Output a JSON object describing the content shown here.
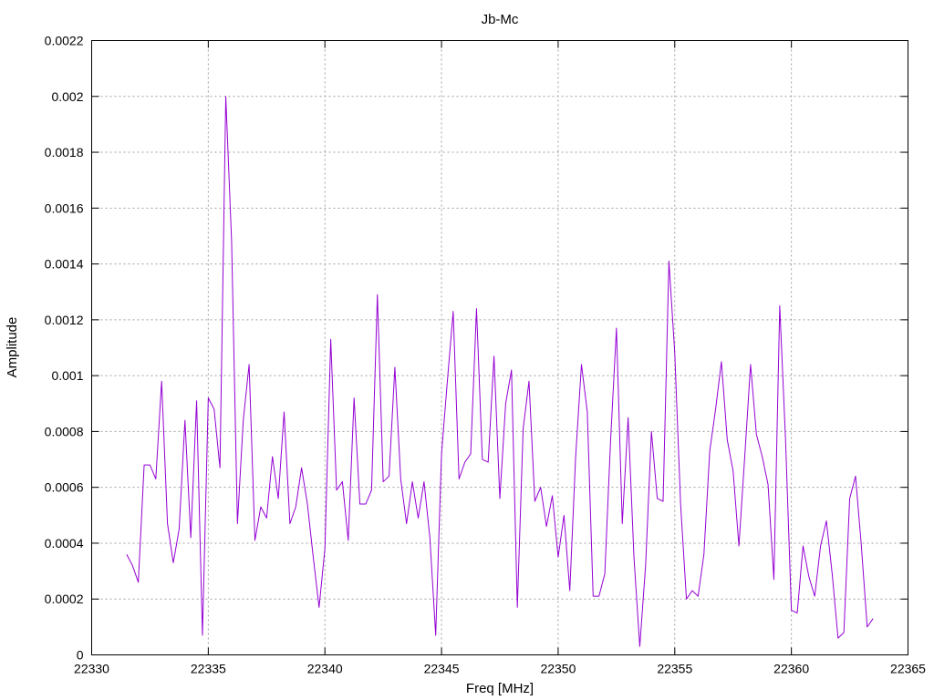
{
  "chart_data": {
    "type": "line",
    "title": "Jb-Mc",
    "xlabel": "Freq [MHz]",
    "ylabel": "Amplitude",
    "xlim": [
      22330,
      22365
    ],
    "ylim": [
      0,
      0.0022
    ],
    "xticks": [
      22330,
      22335,
      22340,
      22345,
      22350,
      22355,
      22360,
      22365
    ],
    "xtick_labels": [
      "22330",
      "22335",
      "22340",
      "22345",
      "22350",
      "22355",
      "22360",
      "22365"
    ],
    "yticks": [
      0,
      0.0002,
      0.0004,
      0.0006,
      0.0008,
      0.001,
      0.0012,
      0.0014,
      0.0016,
      0.0018,
      0.002,
      0.0022
    ],
    "ytick_labels": [
      "0",
      "0.0002",
      "0.0004",
      "0.0006",
      "0.0008",
      "0.001",
      "0.0012",
      "0.0014",
      "0.0016",
      "0.0018",
      "0.002",
      "0.0022"
    ],
    "grid": true,
    "series": [
      {
        "color": "#9400d3",
        "x": [
          22331.5,
          22331.75,
          22332.0,
          22332.25,
          22332.5,
          22332.75,
          22333.0,
          22333.25,
          22333.5,
          22333.75,
          22334.0,
          22334.25,
          22334.5,
          22334.75,
          22335.0,
          22335.25,
          22335.5,
          22335.75,
          22336.0,
          22336.25,
          22336.5,
          22336.75,
          22337.0,
          22337.25,
          22337.5,
          22337.75,
          22338.0,
          22338.25,
          22338.5,
          22338.75,
          22339.0,
          22339.25,
          22339.5,
          22339.75,
          22340.0,
          22340.25,
          22340.5,
          22340.75,
          22341.0,
          22341.25,
          22341.5,
          22341.75,
          22342.0,
          22342.25,
          22342.5,
          22342.75,
          22343.0,
          22343.25,
          22343.5,
          22343.75,
          22344.0,
          22344.25,
          22344.5,
          22344.75,
          22345.0,
          22345.25,
          22345.5,
          22345.75,
          22346.0,
          22346.25,
          22346.5,
          22346.75,
          22347.0,
          22347.25,
          22347.5,
          22347.75,
          22348.0,
          22348.25,
          22348.5,
          22348.75,
          22349.0,
          22349.25,
          22349.5,
          22349.75,
          22350.0,
          22350.25,
          22350.5,
          22350.75,
          22351.0,
          22351.25,
          22351.5,
          22351.75,
          22352.0,
          22352.25,
          22352.5,
          22352.75,
          22353.0,
          22353.25,
          22353.5,
          22353.75,
          22354.0,
          22354.25,
          22354.5,
          22354.75,
          22355.0,
          22355.25,
          22355.5,
          22355.75,
          22356.0,
          22356.25,
          22356.5,
          22356.75,
          22357.0,
          22357.25,
          22357.5,
          22357.75,
          22358.0,
          22358.25,
          22358.5,
          22358.75,
          22359.0,
          22359.25,
          22359.5,
          22359.75,
          22360.0,
          22360.25,
          22360.5,
          22360.75,
          22361.0,
          22361.25,
          22361.5,
          22361.75,
          22362.0,
          22362.25,
          22362.5,
          22362.75,
          22363.0,
          22363.25,
          22363.5
        ],
        "y": [
          0.00036,
          0.00032,
          0.00026,
          0.00068,
          0.00068,
          0.00063,
          0.00098,
          0.00047,
          0.00033,
          0.00045,
          0.00084,
          0.00042,
          0.00091,
          7e-05,
          0.00092,
          0.00088,
          0.00067,
          0.002,
          0.00148,
          0.00047,
          0.00084,
          0.00104,
          0.00041,
          0.00053,
          0.00049,
          0.00071,
          0.00056,
          0.00087,
          0.00047,
          0.00053,
          0.00067,
          0.00054,
          0.00035,
          0.00017,
          0.00038,
          0.00113,
          0.00059,
          0.00062,
          0.00041,
          0.00092,
          0.00054,
          0.00054,
          0.00059,
          0.00129,
          0.00062,
          0.00064,
          0.00103,
          0.00063,
          0.00047,
          0.00062,
          0.00049,
          0.00062,
          0.00042,
          7e-05,
          0.00072,
          0.00098,
          0.00123,
          0.00063,
          0.00069,
          0.00072,
          0.00124,
          0.0007,
          0.00069,
          0.00107,
          0.00056,
          0.0009,
          0.00102,
          0.00017,
          0.00081,
          0.00098,
          0.00055,
          0.0006,
          0.00046,
          0.00057,
          0.00035,
          0.0005,
          0.00023,
          0.00071,
          0.00104,
          0.00087,
          0.00021,
          0.00021,
          0.00029,
          0.00077,
          0.00117,
          0.00047,
          0.00085,
          0.00035,
          3e-05,
          0.00032,
          0.0008,
          0.00056,
          0.00055,
          0.00141,
          0.00108,
          0.00054,
          0.0002,
          0.00023,
          0.00021,
          0.00036,
          0.00073,
          0.00088,
          0.00105,
          0.00077,
          0.00066,
          0.00039,
          0.00071,
          0.00104,
          0.00079,
          0.00071,
          0.00061,
          0.00027,
          0.00125,
          0.00077,
          0.00016,
          0.00015,
          0.00039,
          0.00028,
          0.00021,
          0.00039,
          0.00048,
          0.00029,
          6e-05,
          8e-05,
          0.00056,
          0.00064,
          0.00039,
          0.0001,
          0.00013
        ]
      }
    ]
  }
}
